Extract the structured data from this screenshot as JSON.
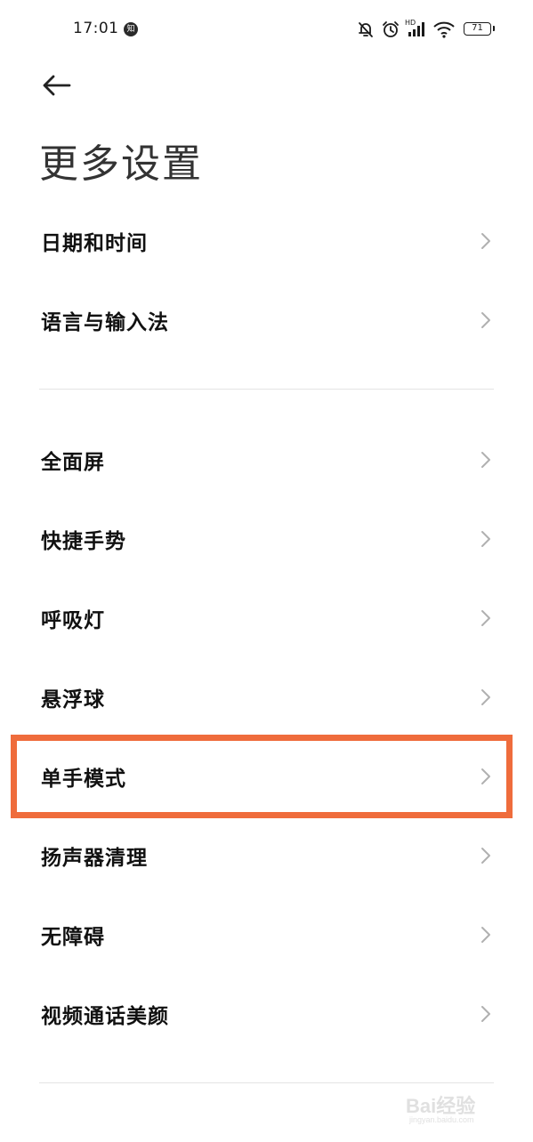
{
  "status_bar": {
    "time": "17:01",
    "notification_badge": "知",
    "battery_level": "71",
    "icons": [
      "mute-bell-icon",
      "alarm-icon",
      "hd-signal-icon",
      "wifi-icon",
      "battery-icon"
    ]
  },
  "header": {
    "back_icon": "arrow-left-icon",
    "title": "更多设置"
  },
  "menu": {
    "items": [
      {
        "label": "日期和时间"
      },
      {
        "label": "语言与输入法"
      },
      {
        "label": "全面屏"
      },
      {
        "label": "快捷手势"
      },
      {
        "label": "呼吸灯"
      },
      {
        "label": "悬浮球"
      },
      {
        "label": "单手模式"
      },
      {
        "label": "扬声器清理"
      },
      {
        "label": "无障碍"
      },
      {
        "label": "视频通话美颜"
      }
    ]
  },
  "annotation": {
    "highlight_color": "#ef6c3c",
    "highlighted_item": "单手模式"
  },
  "watermark": {
    "text": "Bai经验",
    "subtext": "jingyan.baidu.com"
  }
}
